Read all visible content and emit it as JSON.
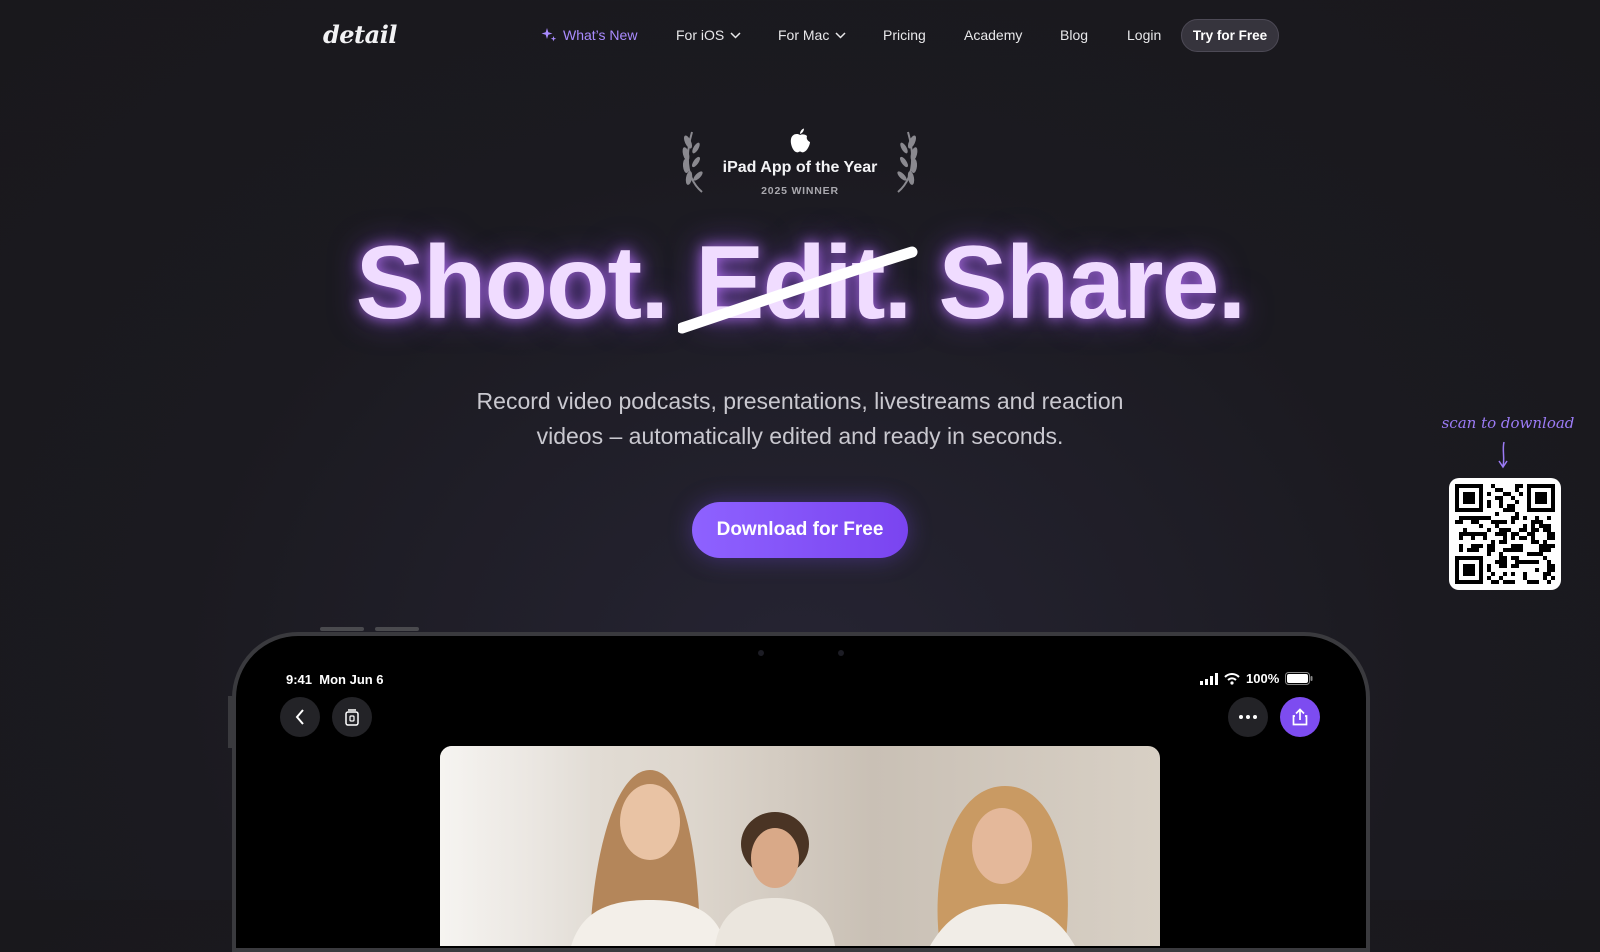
{
  "nav": {
    "logo": "detail",
    "whats_new": "What’s New",
    "for_ios": "For iOS",
    "for_mac": "For Mac",
    "pricing": "Pricing",
    "academy": "Academy",
    "blog": "Blog",
    "login": "Login",
    "try_free": "Try for Free"
  },
  "award": {
    "title": "iPad App of the Year",
    "subtitle": "2025 WINNER"
  },
  "hero": {
    "word1": "Shoot.",
    "word2": "Edit.",
    "word3": "Share.",
    "subtitle_line1": "Record video podcasts, presentations, livestreams and reaction",
    "subtitle_line2": "videos – automatically edited and ready in seconds.",
    "cta": "Download for Free"
  },
  "qr": {
    "caption": "scan to download"
  },
  "device": {
    "time": "9:41",
    "date": "Mon Jun 6",
    "battery": "100%"
  },
  "colors": {
    "accent": "#8e62ff",
    "headline_glow": "#b478ff",
    "background": "#1b1a20"
  }
}
